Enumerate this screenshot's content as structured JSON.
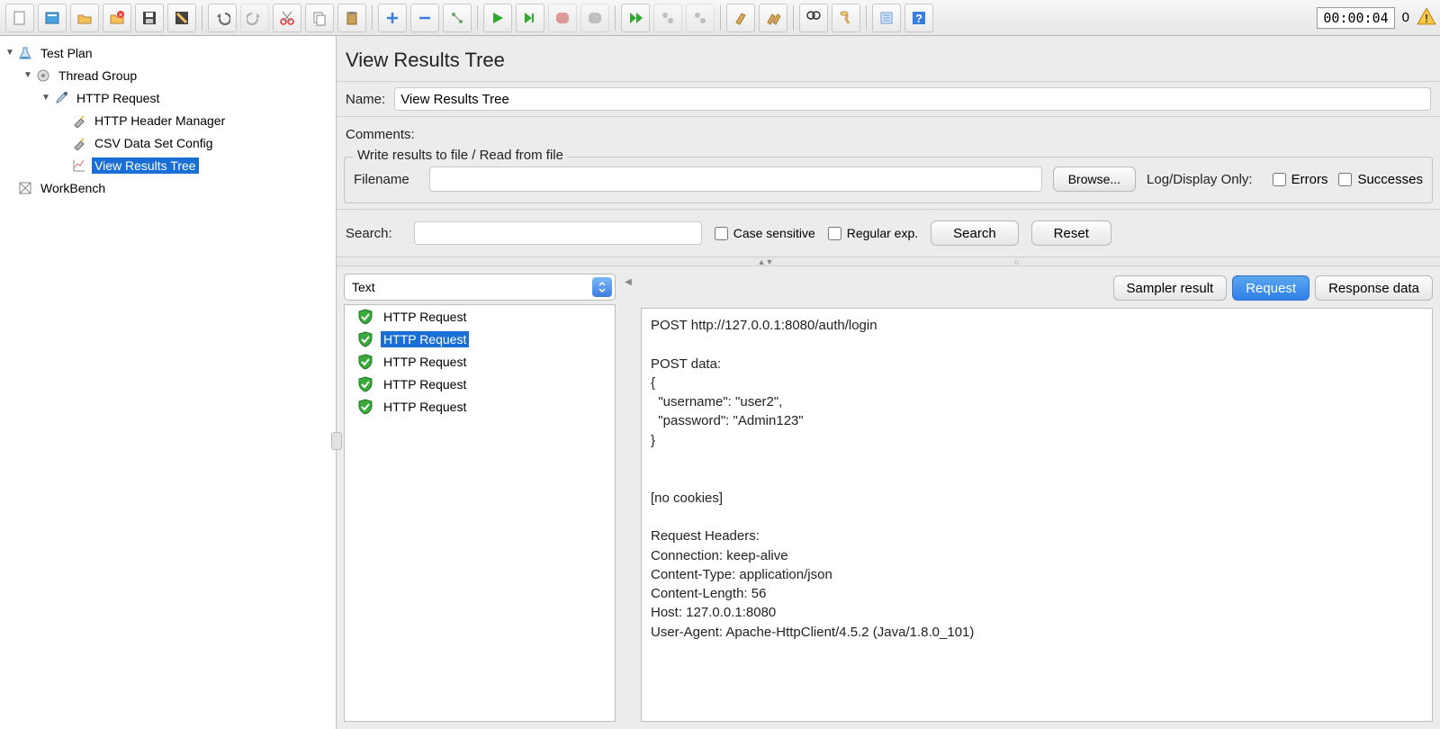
{
  "toolbar": {
    "timer": "00:00:04",
    "threads": "0"
  },
  "tree": {
    "testplan": "Test Plan",
    "threadgroup": "Thread Group",
    "httprequest": "HTTP Request",
    "headermgr": "HTTP Header Manager",
    "csvconfig": "CSV Data Set Config",
    "viewresults": "View Results Tree",
    "workbench": "WorkBench"
  },
  "panel": {
    "title": "View Results Tree",
    "name_label": "Name:",
    "name_value": "View Results Tree",
    "comments_label": "Comments:",
    "fileset_legend": "Write results to file / Read from file",
    "filename_label": "Filename",
    "browse_btn": "Browse...",
    "logdisplay_label": "Log/Display Only:",
    "errors_label": "Errors",
    "successes_label": "Successes",
    "search_label": "Search:",
    "casesensitive_label": "Case sensitive",
    "regex_label": "Regular exp.",
    "search_btn": "Search",
    "reset_btn": "Reset",
    "renderer": "Text",
    "tabs": {
      "sampler": "Sampler result",
      "request": "Request",
      "response": "Response data"
    },
    "results": [
      "HTTP Request",
      "HTTP Request",
      "HTTP Request",
      "HTTP Request",
      "HTTP Request"
    ],
    "request_text": "POST http://127.0.0.1:8080/auth/login\n\nPOST data:\n{\n  \"username\": \"user2\",\n  \"password\": \"Admin123\"\n}\n\n\n[no cookies]\n\nRequest Headers:\nConnection: keep-alive\nContent-Type: application/json\nContent-Length: 56\nHost: 127.0.0.1:8080\nUser-Agent: Apache-HttpClient/4.5.2 (Java/1.8.0_101)"
  }
}
